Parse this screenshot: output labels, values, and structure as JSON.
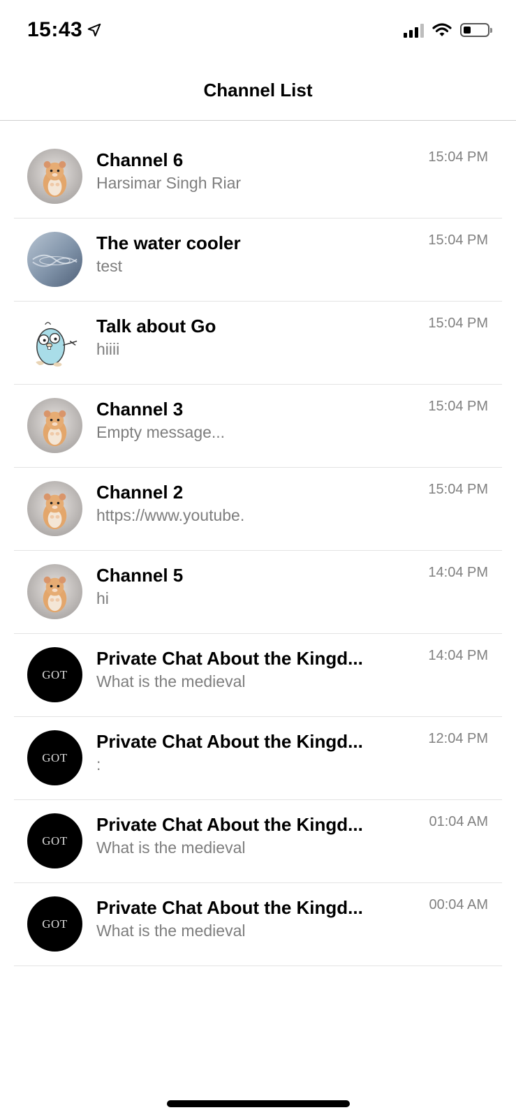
{
  "status_bar": {
    "time": "15:43",
    "location_icon": "location-arrow-icon",
    "signal_icon": "cellular-signal-icon",
    "wifi_icon": "wifi-icon",
    "battery_icon": "battery-icon",
    "battery_level": 0.3
  },
  "nav": {
    "title": "Channel List"
  },
  "channels": [
    {
      "name": "Channel 6",
      "preview": "Harsimar Singh Riar",
      "time": "15:04 PM",
      "avatar": "hamster"
    },
    {
      "name": "The water cooler",
      "preview": "test",
      "time": "15:04 PM",
      "avatar": "water"
    },
    {
      "name": "Talk about Go",
      "preview": "hiiii",
      "time": "15:04 PM",
      "avatar": "gopher"
    },
    {
      "name": "Channel 3",
      "preview": "Empty message...",
      "time": "15:04 PM",
      "avatar": "hamster"
    },
    {
      "name": "Channel 2",
      "preview": "https://www.youtube.",
      "time": "15:04 PM",
      "avatar": "hamster"
    },
    {
      "name": "Channel 5",
      "preview": "hi",
      "time": "14:04 PM",
      "avatar": "hamster"
    },
    {
      "name": "Private Chat About the Kingd...",
      "preview": "What is the medieval",
      "time": "14:04 PM",
      "avatar": "got",
      "avatar_text": "GOT"
    },
    {
      "name": "Private Chat About the Kingd...",
      "preview": ":",
      "time": "12:04 PM",
      "avatar": "got",
      "avatar_text": "GOT"
    },
    {
      "name": "Private Chat About the Kingd...",
      "preview": "What is the medieval",
      "time": "01:04 AM",
      "avatar": "got",
      "avatar_text": "GOT"
    },
    {
      "name": "Private Chat About the Kingd...",
      "preview": "What is the medieval",
      "time": "00:04 AM",
      "avatar": "got",
      "avatar_text": "GOT"
    }
  ],
  "colors": {
    "preview_text": "#7d7d7d",
    "time_text": "#808080",
    "divider": "#e3e3e3"
  }
}
